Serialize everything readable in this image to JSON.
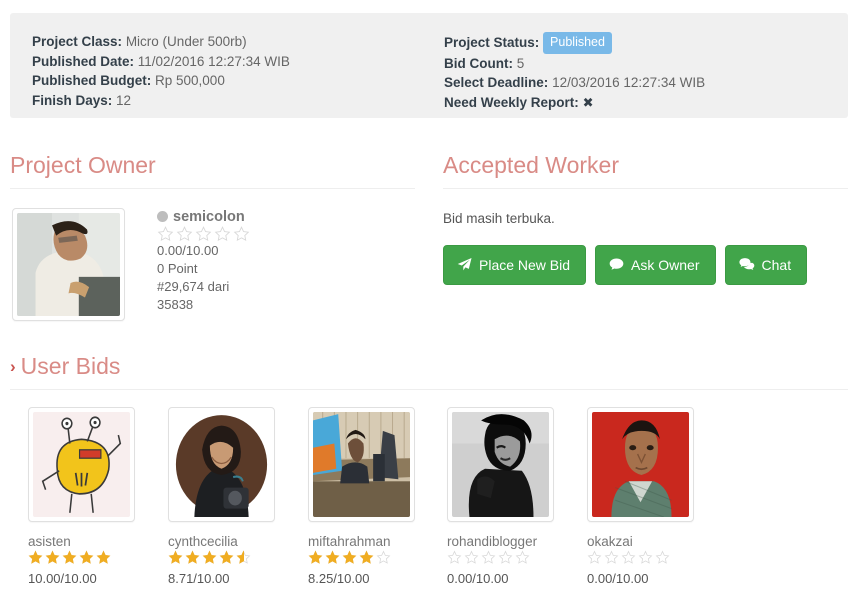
{
  "colors": {
    "panel_bg": "#f0f0f0",
    "heading": "#d98b86",
    "chevron": "#c9534f",
    "badge": "#79b9e8",
    "button_green": "#41a54a",
    "star_on": "#f0ad22",
    "star_off": "#d8d8d8"
  },
  "info": {
    "left": [
      {
        "key": "Project Class:",
        "value": "Micro (Under 500rb)"
      },
      {
        "key": "Published Date:",
        "value": "11/02/2016 12:27:34 WIB"
      },
      {
        "key": "Published Budget:",
        "value": "Rp 500,000"
      },
      {
        "key": "Finish Days:",
        "value": "12"
      }
    ],
    "right": [
      {
        "key": "Project Status:",
        "value": "Published",
        "type": "badge"
      },
      {
        "key": "Bid Count:",
        "value": "5"
      },
      {
        "key": "Select Deadline:",
        "value": "12/03/2016 12:27:34 WIB"
      },
      {
        "key": "Need Weekly Report:",
        "value": "✖",
        "type": "xmark"
      }
    ]
  },
  "sections": {
    "owner_title": "Project Owner",
    "worker_title": "Accepted Worker",
    "bids_title": "User Bids",
    "bids_chevron": "›"
  },
  "owner": {
    "avatar_alt": "owner-photo",
    "status_icon": "circle-icon",
    "name": "semicolon",
    "rating": 0,
    "rating_text": "0.00/10.00",
    "points": "0 Point",
    "rank": "#29,674 dari 35838"
  },
  "worker": {
    "note": "Bid masih terbuka.",
    "buttons": [
      {
        "label": "Place New Bid",
        "icon": "paper-plane-icon"
      },
      {
        "label": "Ask Owner",
        "icon": "comment-icon"
      },
      {
        "label": "Chat",
        "icon": "comments-icon"
      }
    ]
  },
  "bids": [
    {
      "name": "asisten",
      "rating": 5,
      "score": "10.00/10.00",
      "avatar": "asisten-photo"
    },
    {
      "name": "cynthcecilia",
      "rating": 4.5,
      "score": "8.71/10.00",
      "avatar": "cynthcecilia-photo"
    },
    {
      "name": "miftahrahman",
      "rating": 4,
      "score": "8.25/10.00",
      "avatar": "miftahrahman-photo"
    },
    {
      "name": "rohandiblogger",
      "rating": 0,
      "score": "0.00/10.00",
      "avatar": "rohandiblogger-photo"
    },
    {
      "name": "okakzai",
      "rating": 0,
      "score": "0.00/10.00",
      "avatar": "okakzai-photo"
    }
  ]
}
